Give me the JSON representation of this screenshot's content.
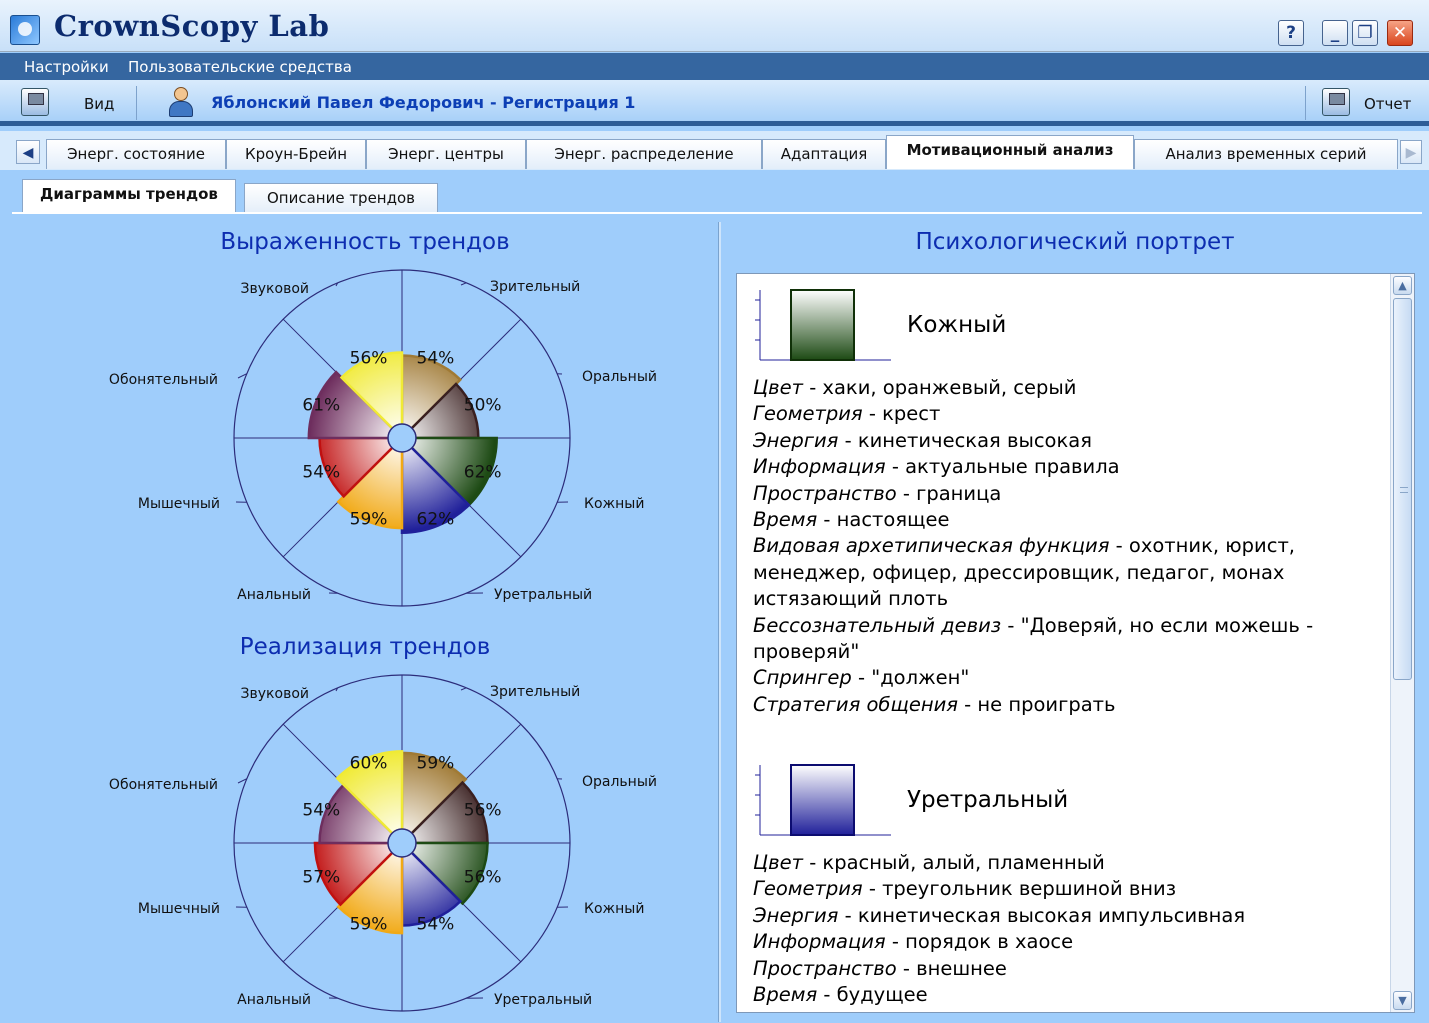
{
  "window": {
    "title": "CrownScopy Lab",
    "buttons": {
      "help": "?",
      "minimize": "_",
      "restore": "❐",
      "close": "✕"
    }
  },
  "menu": [
    "Настройки",
    "Пользовательские средства"
  ],
  "toolbar": {
    "view_label": "Вид",
    "patient": "Яблонский Павел Федорович - Регистрация 1",
    "report_label": "Отчет"
  },
  "tabs": [
    "Энерг. состояние",
    "Кроун-Брейн",
    "Энерг. центры",
    "Энерг. распределение",
    "Адаптация",
    "Мотивационный анализ",
    "Анализ временных серий"
  ],
  "active_tab": "Мотивационный анализ",
  "subtabs": [
    "Диаграммы трендов",
    "Описание трендов"
  ],
  "active_subtab": "Диаграммы трендов",
  "colors": {
    "zritelny": "#a07a35",
    "oralny": "#3a2020",
    "kozhny": "#1d4a14",
    "uretralny": "#20209a",
    "analny": "#f1a915",
    "myshechny": "#c01010",
    "obonyatelny": "#6e2e5e",
    "zvukovoy": "#f0ea35"
  },
  "chart_data": [
    {
      "type": "polar-area",
      "title": "Выраженность трендов",
      "categories": [
        "Зрительный",
        "Оральный",
        "Кожный",
        "Уретральный",
        "Анальный",
        "Мышечный",
        "Обонятельный",
        "Звуковой"
      ],
      "values": [
        54,
        50,
        62,
        62,
        59,
        54,
        61,
        56
      ],
      "unit": "%"
    },
    {
      "type": "polar-area",
      "title": "Реализация трендов",
      "categories": [
        "Зрительный",
        "Оральный",
        "Кожный",
        "Уретральный",
        "Анальный",
        "Мышечный",
        "Обонятельный",
        "Звуковой"
      ],
      "values": [
        59,
        56,
        56,
        54,
        59,
        57,
        54,
        60
      ],
      "unit": "%"
    }
  ],
  "portrait": {
    "title": "Психологический портрет",
    "traits": [
      {
        "name": "Кожный",
        "color": "#1d4a14",
        "lines": [
          {
            "k": "Цвет",
            "v": " - хаки, оранжевый, серый"
          },
          {
            "k": "Геометрия",
            "v": " - крест"
          },
          {
            "k": "Энергия",
            "v": " - кинетическая высокая"
          },
          {
            "k": "Информация",
            "v": " - актуальные правила"
          },
          {
            "k": "Пространство",
            "v": " - граница"
          },
          {
            "k": "Время",
            "v": " - настоящее"
          },
          {
            "k": "Видовая архетипическая функция",
            "v": " - охотник, юрист,"
          },
          {
            "k": "",
            "v": "менеджер, офицер, дрессировщик, педагог, монах"
          },
          {
            "k": "",
            "v": "истязающий плоть"
          },
          {
            "k": "Бессознательный девиз",
            "v": " - \"Доверяй, но если можешь -"
          },
          {
            "k": "",
            "v": "проверяй\""
          },
          {
            "k": "Спрингер",
            "v": " - \"должен\""
          },
          {
            "k": "Стратегия общения",
            "v": " - не проиграть"
          }
        ]
      },
      {
        "name": "Уретральный",
        "color": "#20209a",
        "lines": [
          {
            "k": "Цвет",
            "v": " - красный, алый, пламенный"
          },
          {
            "k": "Геометрия",
            "v": " - треугольник вершиной вниз"
          },
          {
            "k": "Энергия",
            "v": " - кинетическая высокая импульсивная"
          },
          {
            "k": "Информация",
            "v": " - порядок в хаосе"
          },
          {
            "k": "Пространство",
            "v": " - внешнее"
          },
          {
            "k": "Время",
            "v": " - будущее"
          }
        ]
      }
    ]
  }
}
